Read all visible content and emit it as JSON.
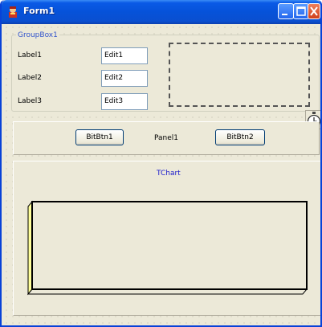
{
  "window": {
    "title": "Form1"
  },
  "groupbox": {
    "caption": "GroupBox1",
    "rows": [
      {
        "label": "Label1",
        "edit_value": "Edit1"
      },
      {
        "label": "Label2",
        "edit_value": "Edit2"
      },
      {
        "label": "Label3",
        "edit_value": "Edit3"
      }
    ]
  },
  "panel": {
    "caption": "Panel1",
    "button1_label": "BitBtn1",
    "button2_label": "BitBtn2"
  },
  "chart": {
    "title": "TChart"
  },
  "colors": {
    "titlebar": "#0652d9",
    "chart_title": "#1a1acc",
    "group_caption": "#3355cc",
    "chart_wall": "#ffff99"
  },
  "icons": {
    "app": "app-icon",
    "minimize": "minimize-icon",
    "maximize": "maximize-icon",
    "close": "close-icon",
    "timer": "timer-icon"
  },
  "chart_data": {
    "type": "bar",
    "title": "TChart",
    "series": [],
    "categories": []
  }
}
